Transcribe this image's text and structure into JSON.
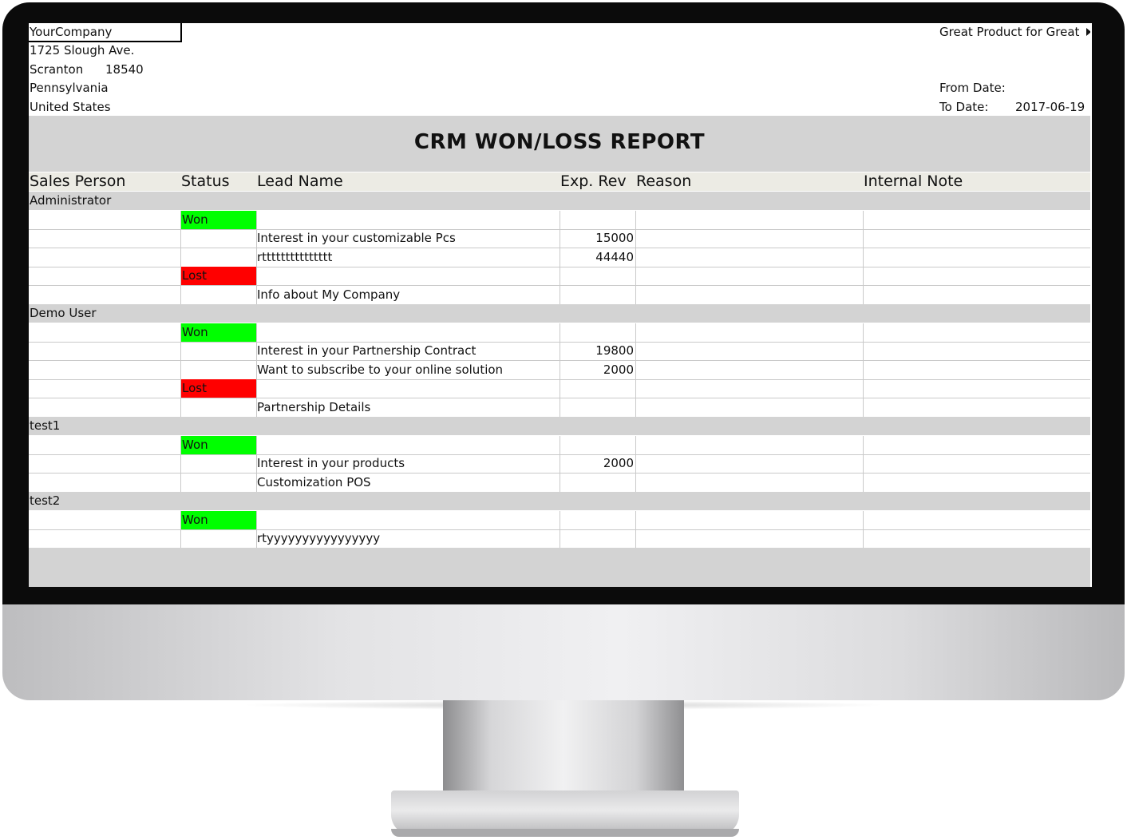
{
  "report": {
    "company": {
      "name": "YourCompany",
      "street": "1725 Slough Ave.",
      "city": "Scranton",
      "zip": "18540",
      "state": "Pennsylvania",
      "country": "United States"
    },
    "tagline": "Great Product for Great",
    "from_date_label": "From Date:",
    "from_date": "",
    "to_date_label": "To Date:",
    "to_date": "2017-06-19",
    "title": "CRM WON/LOSS REPORT",
    "columns": [
      "Sales Person",
      "Status",
      "Lead Name",
      "Exp. Rev",
      "Reason",
      "Internal Note"
    ]
  },
  "rows": [
    {
      "kind": "group",
      "sales_person": "Administrator"
    },
    {
      "kind": "status",
      "status": "Won"
    },
    {
      "kind": "lead",
      "lead": "Interest in your customizable Pcs",
      "rev": "15000"
    },
    {
      "kind": "lead",
      "lead": "rttttttttttttttt",
      "rev": "44440"
    },
    {
      "kind": "status",
      "status": "Lost"
    },
    {
      "kind": "lead",
      "lead": "Info about My Company",
      "rev": ""
    },
    {
      "kind": "group",
      "sales_person": "Demo User"
    },
    {
      "kind": "status",
      "status": "Won"
    },
    {
      "kind": "lead",
      "lead": "Interest in your Partnership Contract",
      "rev": "19800"
    },
    {
      "kind": "lead",
      "lead": "Want to subscribe to your online solution",
      "rev": "2000"
    },
    {
      "kind": "status",
      "status": "Lost"
    },
    {
      "kind": "lead",
      "lead": "Partnership Details",
      "rev": ""
    },
    {
      "kind": "group",
      "sales_person": "test1"
    },
    {
      "kind": "status",
      "status": "Won"
    },
    {
      "kind": "lead",
      "lead": "Interest in your products",
      "rev": "2000"
    },
    {
      "kind": "lead",
      "lead": "Customization POS",
      "rev": ""
    },
    {
      "kind": "group",
      "sales_person": "test2"
    },
    {
      "kind": "status",
      "status": "Won"
    },
    {
      "kind": "lead",
      "lead": "rtyyyyyyyyyyyyyyyy",
      "rev": ""
    }
  ],
  "colors": {
    "won": "#00ff00",
    "lost": "#ff0000",
    "group_band": "#d3d3d3",
    "header_band": "#ecebe4"
  }
}
